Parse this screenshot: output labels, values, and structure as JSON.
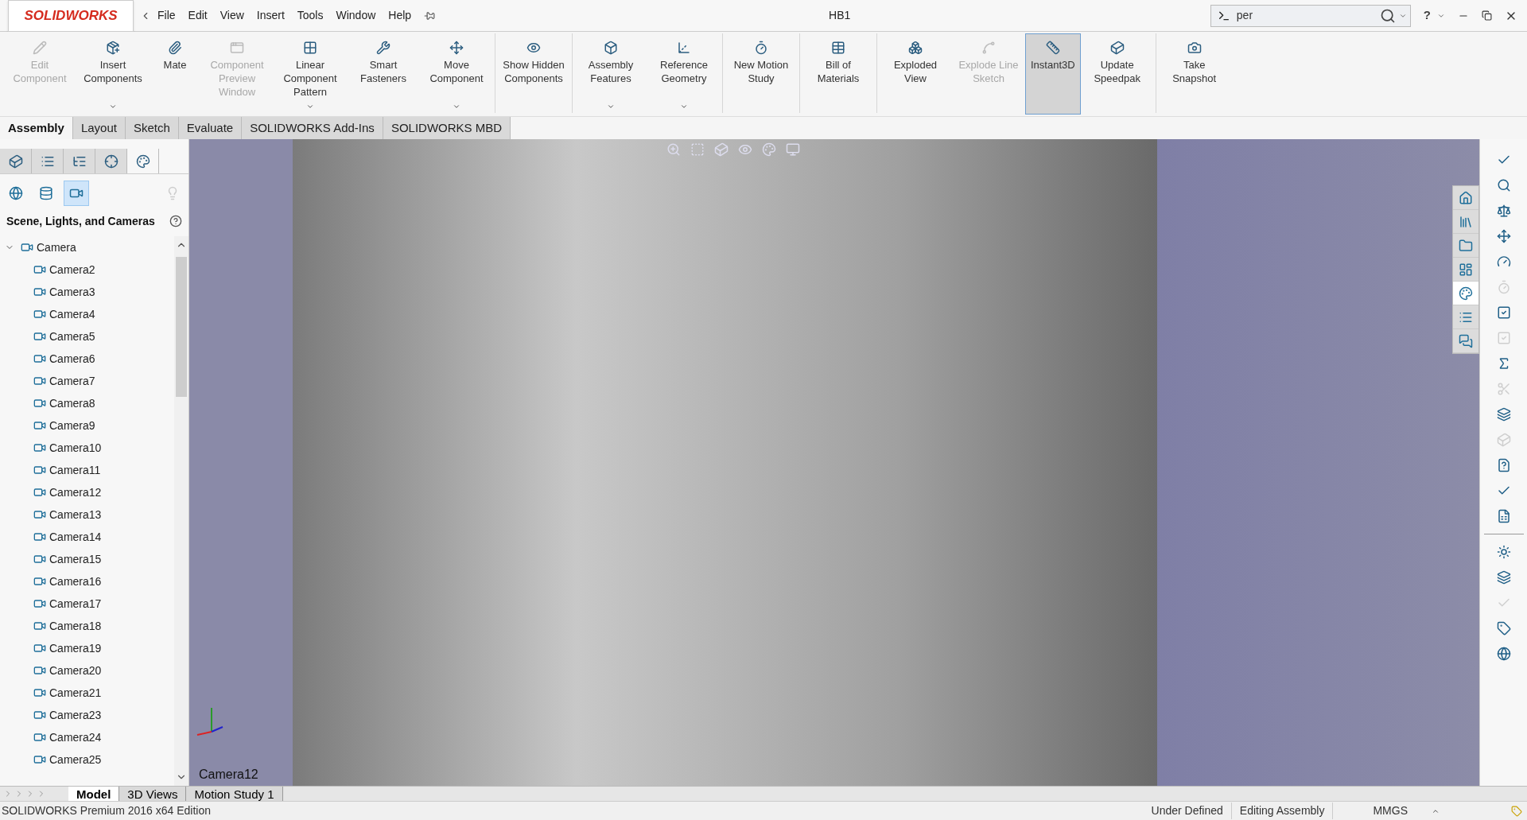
{
  "title_bar": {
    "logo": "SOLIDWORKS",
    "menu": [
      "File",
      "Edit",
      "View",
      "Insert",
      "Tools",
      "Window",
      "Help"
    ],
    "document_title": "HB1",
    "search": {
      "value": "per"
    },
    "help": "?"
  },
  "ribbon": {
    "groups": [
      [
        {
          "label": "Edit Component",
          "disabled": true,
          "selected": false,
          "dropdown": false
        },
        {
          "label": "Insert Components",
          "disabled": false,
          "selected": false,
          "dropdown": true
        },
        {
          "label": "Mate",
          "disabled": false,
          "selected": false,
          "dropdown": false
        },
        {
          "label": "Component Preview Window",
          "disabled": true,
          "selected": false,
          "dropdown": false
        },
        {
          "label": "Linear Component Pattern",
          "disabled": false,
          "selected": false,
          "dropdown": true
        },
        {
          "label": "Smart Fasteners",
          "disabled": false,
          "selected": false,
          "dropdown": false
        },
        {
          "label": "Move Component",
          "disabled": false,
          "selected": false,
          "dropdown": true
        }
      ],
      [
        {
          "label": "Show Hidden Components",
          "disabled": false,
          "selected": false,
          "dropdown": false
        }
      ],
      [
        {
          "label": "Assembly Features",
          "disabled": false,
          "selected": false,
          "dropdown": true
        },
        {
          "label": "Reference Geometry",
          "disabled": false,
          "selected": false,
          "dropdown": true
        }
      ],
      [
        {
          "label": "New Motion Study",
          "disabled": false,
          "selected": false,
          "dropdown": false
        }
      ],
      [
        {
          "label": "Bill of Materials",
          "disabled": false,
          "selected": false,
          "dropdown": false
        }
      ],
      [
        {
          "label": "Exploded View",
          "disabled": false,
          "selected": false,
          "dropdown": false
        },
        {
          "label": "Explode Line Sketch",
          "disabled": true,
          "selected": false,
          "dropdown": false
        },
        {
          "label": "Instant3D",
          "disabled": false,
          "selected": true,
          "dropdown": false
        },
        {
          "label": "Update Speedpak",
          "disabled": false,
          "selected": false,
          "dropdown": false
        }
      ],
      [
        {
          "label": "Take Snapshot",
          "disabled": false,
          "selected": false,
          "dropdown": false
        }
      ]
    ]
  },
  "command_tabs": [
    {
      "label": "Assembly",
      "selected": true
    },
    {
      "label": "Layout",
      "selected": false
    },
    {
      "label": "Sketch",
      "selected": false
    },
    {
      "label": "Evaluate",
      "selected": false
    },
    {
      "label": "SOLIDWORKS Add-Ins",
      "selected": false
    },
    {
      "label": "SOLIDWORKS MBD",
      "selected": false
    }
  ],
  "manager_tabs": [
    {
      "selected": false
    },
    {
      "selected": false
    },
    {
      "selected": false
    },
    {
      "selected": false
    },
    {
      "selected": true
    }
  ],
  "panel": {
    "filters": [
      {
        "selected": false,
        "disabled": false
      },
      {
        "selected": false,
        "disabled": false
      },
      {
        "selected": true,
        "disabled": false
      },
      {
        "selected": false,
        "disabled": true
      }
    ],
    "heading": "Scene, Lights, and Cameras",
    "tree": [
      {
        "label": "Camera",
        "expanded": true,
        "children": [
          {
            "label": "Camera2"
          },
          {
            "label": "Camera3"
          },
          {
            "label": "Camera4"
          },
          {
            "label": "Camera5"
          },
          {
            "label": "Camera6"
          },
          {
            "label": "Camera7"
          },
          {
            "label": "Camera8"
          },
          {
            "label": "Camera9"
          },
          {
            "label": "Camera10"
          },
          {
            "label": "Camera11"
          },
          {
            "label": "Camera12"
          },
          {
            "label": "Camera13"
          },
          {
            "label": "Camera14"
          },
          {
            "label": "Camera15"
          },
          {
            "label": "Camera16"
          },
          {
            "label": "Camera17"
          },
          {
            "label": "Camera18"
          },
          {
            "label": "Camera19"
          },
          {
            "label": "Camera20"
          },
          {
            "label": "Camera21"
          },
          {
            "label": "Camera23"
          },
          {
            "label": "Camera24"
          },
          {
            "label": "Camera25"
          }
        ]
      }
    ]
  },
  "viewport": {
    "camera_label": "Camera12"
  },
  "task_pane_tabs": [
    {
      "selected": false
    },
    {
      "selected": false
    },
    {
      "selected": false
    },
    {
      "selected": false
    },
    {
      "selected": true
    },
    {
      "selected": false
    },
    {
      "selected": false
    }
  ],
  "tools": [
    {
      "disabled": false
    },
    {
      "disabled": false
    },
    {
      "disabled": false
    },
    {
      "disabled": false
    },
    {
      "disabled": false
    },
    {
      "disabled": true
    },
    {
      "disabled": false
    },
    {
      "disabled": true
    },
    {
      "disabled": false
    },
    {
      "disabled": true
    },
    {
      "disabled": false
    },
    {
      "disabled": true
    },
    {
      "disabled": false
    },
    {
      "disabled": false
    },
    {
      "disabled": false
    },
    {
      "disabled": false
    },
    {
      "disabled": false
    },
    {
      "disabled": true
    },
    {
      "disabled": false
    },
    {
      "disabled": false
    }
  ],
  "bottom_tabs": [
    {
      "label": "Model",
      "selected": true
    },
    {
      "label": "3D Views",
      "selected": false
    },
    {
      "label": "Motion Study 1",
      "selected": false
    }
  ],
  "status_bar": {
    "edition": "SOLIDWORKS Premium 2016 x64 Edition",
    "definition": "Under Defined",
    "mode": "Editing Assembly",
    "units": "MMGS"
  }
}
